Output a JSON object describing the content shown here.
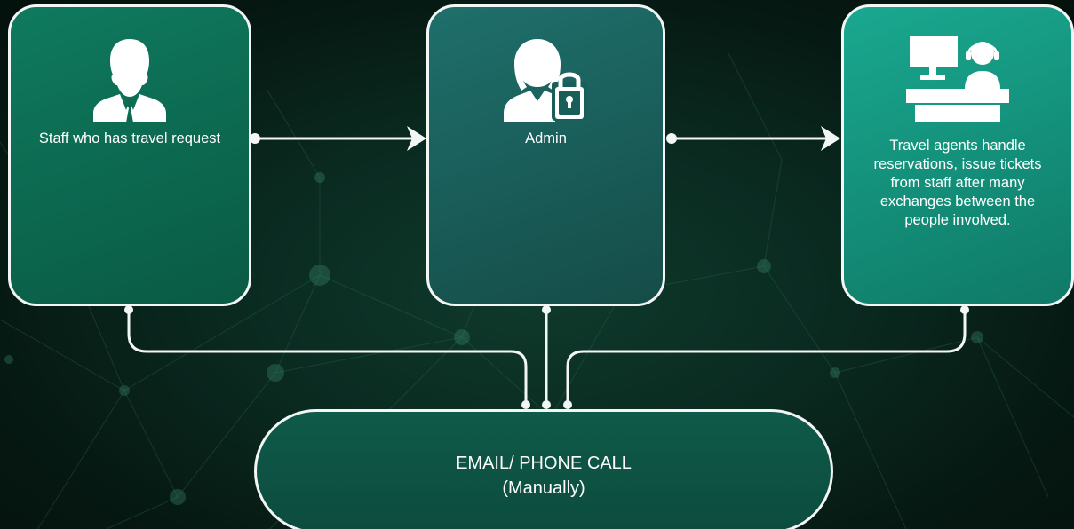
{
  "colors": {
    "background": "#0a2a20",
    "card_staff": "#0c6a51",
    "card_admin": "#1a5e5a",
    "card_agent": "#14917b",
    "pill": "#0c4c3e",
    "stroke": "#f2f6f4"
  },
  "nodes": {
    "staff": {
      "icon": "businessman-icon",
      "label": "Staff who has travel request"
    },
    "admin": {
      "icon": "admin-lock-icon",
      "label": "Admin"
    },
    "agent": {
      "icon": "travel-agent-desk-icon",
      "label": "Travel agents handle reservations, issue tickets from staff after many exchanges between the people involved."
    }
  },
  "channel": {
    "title": "EMAIL/ PHONE CALL",
    "subtitle": "(Manually)"
  },
  "edges": [
    {
      "from": "staff",
      "to": "admin",
      "type": "arrow"
    },
    {
      "from": "admin",
      "to": "agent",
      "type": "arrow"
    },
    {
      "from": "staff",
      "to": "channel",
      "type": "line"
    },
    {
      "from": "admin",
      "to": "channel",
      "type": "line"
    },
    {
      "from": "agent",
      "to": "channel",
      "type": "line"
    }
  ]
}
